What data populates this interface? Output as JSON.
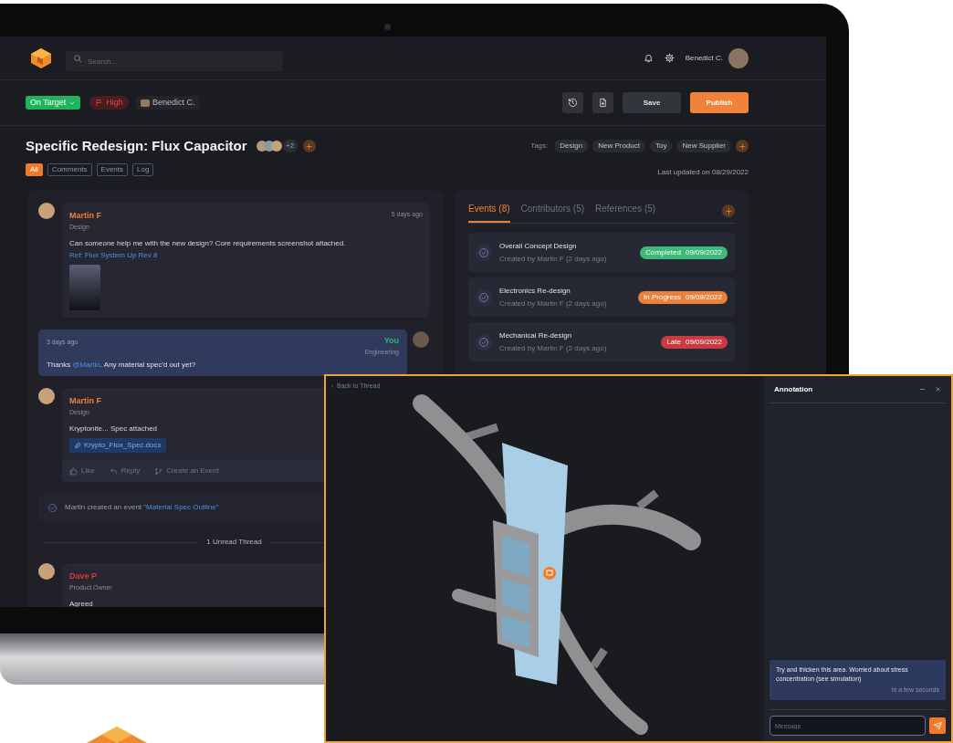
{
  "header": {
    "search_placeholder": "Search...",
    "user_name": "Benedict C."
  },
  "project": {
    "status": "On Target",
    "priority": "High",
    "owner": "Benedict C."
  },
  "actions": [
    {
      "kind": "history"
    },
    {
      "kind": "add_file"
    },
    {
      "kind": "secondary",
      "label": "Save"
    },
    {
      "kind": "primary",
      "label": "Publish"
    }
  ],
  "title": "Specific Redesign: Flux Capacitor",
  "contributors_more": "+2",
  "filters": [
    {
      "label": "All",
      "selected": true
    },
    {
      "label": "Comments",
      "selected": false
    },
    {
      "label": "Events",
      "selected": false
    },
    {
      "label": "Log",
      "selected": false
    }
  ],
  "tags_label": "Tags:",
  "tags": [
    "Design",
    "New Product",
    "Toy",
    "New Supplier"
  ],
  "last_updated": "Last updated on 08/29/2022",
  "thread": [
    {
      "kind": "comment",
      "author": "Martin F",
      "color": "#e8823a",
      "role": "Design",
      "time": "5 days ago",
      "body": [
        {
          "kind": "text",
          "text": "Can someone help me with the new design? Core requirements screenshot attached. "
        },
        {
          "kind": "link",
          "text": "Ref: Flux System Up Rev 8"
        }
      ],
      "image": true
    },
    {
      "kind": "own",
      "author": "You",
      "color": "#2fb36b",
      "role": "Engineering",
      "time": "3 days ago",
      "body": [
        {
          "kind": "text",
          "text": "Thanks "
        },
        {
          "kind": "link",
          "text": "@Martin"
        },
        {
          "kind": "text",
          "text": ". Any material spec'd out yet?"
        }
      ]
    },
    {
      "kind": "comment",
      "author": "Martin F",
      "color": "#e8823a",
      "role": "Design",
      "body": [
        {
          "kind": "text",
          "text": "Kryptonite... Spec attached"
        }
      ],
      "file": "Krypto_Flux_Spec.docx",
      "reactions": [
        {
          "kind": "like",
          "label": "Like"
        },
        {
          "kind": "reply",
          "label": "Reply"
        },
        {
          "kind": "event",
          "label": "Create an Event"
        }
      ]
    },
    {
      "kind": "event",
      "body": [
        {
          "kind": "text",
          "text": "Martin created an event "
        },
        {
          "kind": "link",
          "text": "\"Material Spec Outline\""
        }
      ]
    },
    {
      "kind": "divider",
      "label": "1 Unread Thread"
    },
    {
      "kind": "comment",
      "author": "Dave P",
      "color": "#d23c3c",
      "role": "Product Owner",
      "body": [
        {
          "kind": "text",
          "text": "Agreed"
        }
      ]
    }
  ],
  "panel": {
    "tabs": [
      {
        "label": "Events (8)",
        "selected": true
      },
      {
        "label": "Contributors (5)",
        "selected": false
      },
      {
        "label": "References (5)",
        "selected": false
      }
    ],
    "events": [
      {
        "title": "Overall Concept Design",
        "subtitle": "Created by Martin F (2 days ago)",
        "status": "Completed",
        "date": "09/09/2022",
        "color": "#3dba78"
      },
      {
        "title": "Electronics Re-design",
        "subtitle": "Created by Martin F (2 days ago)",
        "status": "In Progress",
        "date": "09/09/2022",
        "color": "#e8823a"
      },
      {
        "title": "Mechanical Re-design",
        "subtitle": "Created by Martin F (2 days ago)",
        "status": "Late",
        "date": "09/09/2022",
        "color": "#cc3a40"
      }
    ]
  },
  "annotation": {
    "back": "Back to Thread",
    "title": "Annotation",
    "message": {
      "text": "Try and thicken this area. Worried about stress concentration (see simulation)",
      "time": "in a few seconds"
    },
    "input_placeholder": "Message"
  }
}
